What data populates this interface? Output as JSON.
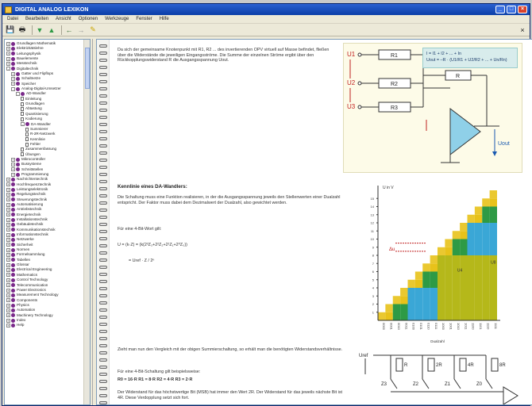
{
  "window": {
    "title": "DIGITAL ANALOG LEXIKON"
  },
  "menu": [
    "Datei",
    "Bearbeiten",
    "Ansicht",
    "Optionen",
    "Werkzeuge",
    "Fenster",
    "Hilfe"
  ],
  "toolbar": [
    "save-icon",
    "print-icon",
    "arrow-down-icon",
    "arrow-up-icon",
    "back-icon",
    "forward-icon",
    "pencil-icon"
  ],
  "tree": {
    "items": [
      {
        "label": "Grundlagen Mathematik",
        "level": 0,
        "exp": "+",
        "color": "#7a2a8a"
      },
      {
        "label": "Elektrizitätslehre",
        "level": 0,
        "exp": "+",
        "color": "#7a2a8a"
      },
      {
        "label": "Leitungsphysik",
        "level": 0,
        "exp": "+",
        "color": "#7a2a8a"
      },
      {
        "label": "Bauelemente",
        "level": 0,
        "exp": "+",
        "color": "#7a2a8a"
      },
      {
        "label": "Messtechnik",
        "level": 0,
        "exp": "+",
        "color": "#7a2a8a"
      },
      {
        "label": "Digitaltechnik",
        "level": 0,
        "exp": "-",
        "color": "#7a2a8a"
      },
      {
        "label": "Gatter und Flipflops",
        "level": 1,
        "exp": "+",
        "color": "#7a2a8a"
      },
      {
        "label": "Schaltnetze",
        "level": 1,
        "exp": "+",
        "color": "#7a2a8a"
      },
      {
        "label": "Speicher",
        "level": 1,
        "exp": "+",
        "color": "#7a2a8a"
      },
      {
        "label": "Analog-Digital-Umsetzer",
        "level": 1,
        "exp": "-",
        "color": "#7a2a8a"
      },
      {
        "label": "AD-Wandler",
        "level": 2,
        "exp": "-",
        "color": "#7a2a8a"
      },
      {
        "label": "Einleitung",
        "level": 3,
        "exp": "",
        "color": ""
      },
      {
        "label": "Grundlagen",
        "level": 3,
        "exp": "",
        "color": ""
      },
      {
        "label": "Abtastung",
        "level": 3,
        "exp": "",
        "color": ""
      },
      {
        "label": "Quantisierung",
        "level": 3,
        "exp": "",
        "color": ""
      },
      {
        "label": "Kodierung",
        "level": 3,
        "exp": "",
        "color": ""
      },
      {
        "label": "DA-Wandler",
        "level": 3,
        "exp": "-",
        "color": "#7a2a8a"
      },
      {
        "label": "Summierer",
        "level": 4,
        "exp": "",
        "color": ""
      },
      {
        "label": "R-2R-Netzwerk",
        "level": 4,
        "exp": "",
        "color": ""
      },
      {
        "label": "Kennlinie",
        "level": 4,
        "exp": "",
        "color": ""
      },
      {
        "label": "Fehler",
        "level": 4,
        "exp": "",
        "color": ""
      },
      {
        "label": "Zusammenfassung",
        "level": 3,
        "exp": "",
        "color": ""
      },
      {
        "label": "Übungen",
        "level": 3,
        "exp": "",
        "color": ""
      },
      {
        "label": "Mikrocontroller",
        "level": 1,
        "exp": "+",
        "color": "#7a2a8a"
      },
      {
        "label": "Bussysteme",
        "level": 1,
        "exp": "+",
        "color": "#7a2a8a"
      },
      {
        "label": "Schnittstellen",
        "level": 1,
        "exp": "+",
        "color": "#7a2a8a"
      },
      {
        "label": "Programmierung",
        "level": 1,
        "exp": "+",
        "color": "#7a2a8a"
      },
      {
        "label": "Nachrichtentechnik",
        "level": 0,
        "exp": "+",
        "color": "#7a2a8a"
      },
      {
        "label": "Hochfrequenztechnik",
        "level": 0,
        "exp": "+",
        "color": "#7a2a8a"
      },
      {
        "label": "Leistungselektronik",
        "level": 0,
        "exp": "+",
        "color": "#7a2a8a"
      },
      {
        "label": "Regelungstechnik",
        "level": 0,
        "exp": "+",
        "color": "#7a2a8a"
      },
      {
        "label": "Steuerungstechnik",
        "level": 0,
        "exp": "+",
        "color": "#7a2a8a"
      },
      {
        "label": "Automatisierung",
        "level": 0,
        "exp": "+",
        "color": "#7a2a8a"
      },
      {
        "label": "Antriebstechnik",
        "level": 0,
        "exp": "+",
        "color": "#7a2a8a"
      },
      {
        "label": "Energietechnik",
        "level": 0,
        "exp": "+",
        "color": "#7a2a8a"
      },
      {
        "label": "Installationstechnik",
        "level": 0,
        "exp": "+",
        "color": "#7a2a8a"
      },
      {
        "label": "Gebäudetechnik",
        "level": 0,
        "exp": "+",
        "color": "#7a2a8a"
      },
      {
        "label": "Kommunikationstechnik",
        "level": 0,
        "exp": "+",
        "color": "#7a2a8a"
      },
      {
        "label": "Informationstechnik",
        "level": 0,
        "exp": "+",
        "color": "#7a2a8a"
      },
      {
        "label": "Netzwerke",
        "level": 0,
        "exp": "+",
        "color": "#7a2a8a"
      },
      {
        "label": "Sicherheit",
        "level": 0,
        "exp": "+",
        "color": "#7a2a8a"
      },
      {
        "label": "Normen",
        "level": 0,
        "exp": "+",
        "color": "#7a2a8a"
      },
      {
        "label": "Formelsammlung",
        "level": 0,
        "exp": "+",
        "color": "#7a2a8a"
      },
      {
        "label": "Tabellen",
        "level": 0,
        "exp": "+",
        "color": "#7a2a8a"
      },
      {
        "label": "Glossar",
        "level": 0,
        "exp": "+",
        "color": "#7a2a8a"
      },
      {
        "label": "Electrical Engineering",
        "level": 0,
        "exp": "+",
        "color": "#7a2a8a"
      },
      {
        "label": "Mathematics",
        "level": 0,
        "exp": "+",
        "color": "#7a2a8a"
      },
      {
        "label": "Control Technology",
        "level": 0,
        "exp": "+",
        "color": "#7a2a8a"
      },
      {
        "label": "Telecommunication",
        "level": 0,
        "exp": "+",
        "color": "#7a2a8a"
      },
      {
        "label": "Power Electronics",
        "level": 0,
        "exp": "+",
        "color": "#7a2a8a"
      },
      {
        "label": "Measurement Technology",
        "level": 0,
        "exp": "+",
        "color": "#7a2a8a"
      },
      {
        "label": "Components",
        "level": 0,
        "exp": "+",
        "color": "#7a2a8a"
      },
      {
        "label": "Physics",
        "level": 0,
        "exp": "+",
        "color": "#7a2a8a"
      },
      {
        "label": "Automation",
        "level": 0,
        "exp": "+",
        "color": "#7a2a8a"
      },
      {
        "label": "Machinery Technology",
        "level": 0,
        "exp": "+",
        "color": "#7a2a8a"
      },
      {
        "label": "Index",
        "level": 0,
        "exp": "+",
        "color": "#7a2a8a"
      },
      {
        "label": "Help",
        "level": 0,
        "exp": "+",
        "color": "#7a2a8a"
      }
    ]
  },
  "doc": {
    "para1": "Da sich der gemeinsame Knotenpunkt mit R1, R2 ... des invertierenden OPV virtuell auf Masse befindet, fließen über die Widerstände die jeweiligen Eingangsströme. Die Summe der einzelnen Ströme ergibt über den Rückkopplungswiderstand R die Ausgangsspannung Uout.",
    "heading2": "Kennlinie eines DA-Wandlers:",
    "para2": "Die Schaltung muss eine Funktion realisieren, in der die Ausgangsspannung jeweils den Stellenwerten einer Dualzahl entspricht. Der Faktor muss dabei dem Dezimalwert der Dualzahl, also gewichtet werden.",
    "para3": "Für eine 4-Bit-Wort gilt:",
    "formula1": "U = (k·Z) = (k(2³Z₃+2²Z₂+2¹Z₁+2⁰Z₀))",
    "formula2": "= Uref · Z / 2ⁿ",
    "para4": "Zieht man nun den Vergleich mit der obigen Summierschaltung, so erhält man die benötigten Widerstandsverhältnisse.",
    "para5": "Für eine 4-Bit-Schaltung gilt beispielsweise:",
    "formula3": "R0 = 16·R    R1 = 8·R    R2 = 4·R    R3 = 2·R",
    "para6": "Der Widerstand für das höchstwertige Bit (MSB) hat immer den Wert 2R. Der Widerstand für das jeweils nächste Bit ist 4R. Diese Verdopplung setzt sich fort."
  },
  "circuit1": {
    "labels": [
      "U1",
      "U2",
      "U3",
      "R1",
      "R2",
      "R3",
      "R",
      "Uout"
    ],
    "eq1": "I = I1 + I2 + ... + In",
    "eq2": "Uout = –R · (U1/R1 + U2/R2 + ... + Un/Rn)"
  },
  "chart_data": {
    "type": "bar",
    "title": "",
    "ylabel": "U in V",
    "xlabel": "Dualzahl",
    "categories": [
      "0000",
      "0001",
      "0010",
      "0011",
      "0100",
      "0101",
      "0110",
      "0111",
      "1000",
      "1001",
      "1010",
      "1011",
      "1100",
      "1101",
      "1110",
      "1111"
    ],
    "values": [
      0,
      1,
      2,
      3,
      4,
      5,
      6,
      7,
      8,
      9,
      10,
      11,
      12,
      13,
      14,
      15
    ],
    "ylim": [
      0,
      16
    ],
    "yticks": [
      1,
      2,
      3,
      4,
      5,
      6,
      7,
      8,
      9,
      10,
      11,
      12,
      13,
      14,
      15
    ],
    "annotation": "Δu",
    "colors": {
      "bit3": "#b5b81a",
      "bit2": "#3aa7d6",
      "bit1": "#2e9a45",
      "bit0": "#e8c21a"
    },
    "stack_labels": {
      "bit3": "U8",
      "bit2": "U4"
    }
  },
  "circuit2": {
    "labels": [
      "Uref",
      "R",
      "2R",
      "4R",
      "8R",
      "Z3",
      "Z2",
      "Z1",
      "Z0"
    ]
  }
}
